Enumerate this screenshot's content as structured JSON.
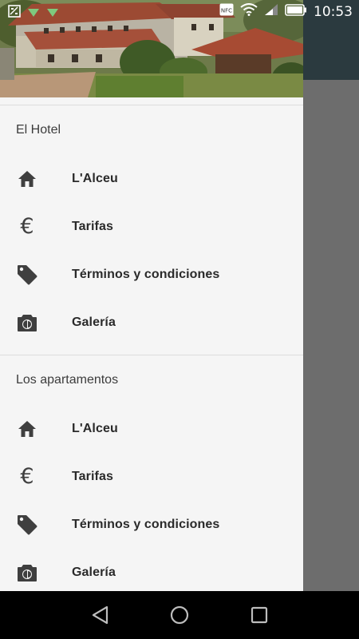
{
  "status_bar": {
    "time": "10:53",
    "icons": [
      "screenshot-icon",
      "download-icon",
      "download-icon",
      "nfc-icon",
      "wifi-icon",
      "signal-icon",
      "battery-icon"
    ],
    "nfc_text": "NFC"
  },
  "drawer": {
    "header_image": "hotel-photo",
    "sections": [
      {
        "title": "El Hotel",
        "items": [
          {
            "label": "L'Alceu",
            "icon": "home-icon"
          },
          {
            "label": "Tarifas",
            "icon": "euro-icon"
          },
          {
            "label": "Términos y condiciones",
            "icon": "tag-icon"
          },
          {
            "label": "Galería",
            "icon": "camera-icon"
          }
        ]
      },
      {
        "title": "Los apartamentos",
        "items": [
          {
            "label": "L'Alceu",
            "icon": "home-icon"
          },
          {
            "label": "Tarifas",
            "icon": "euro-icon"
          },
          {
            "label": "Términos y condiciones",
            "icon": "tag-icon"
          },
          {
            "label": "Galería",
            "icon": "camera-icon"
          }
        ]
      }
    ]
  },
  "euro_symbol": "€",
  "nav_bar": {
    "buttons": [
      "back-icon",
      "home-nav-icon",
      "recents-icon"
    ]
  },
  "colors": {
    "drawer_bg": "#f5f5f5",
    "scrim": "#6b6b6b",
    "icon": "#3f3f3f",
    "nav_bar": "#000000"
  }
}
